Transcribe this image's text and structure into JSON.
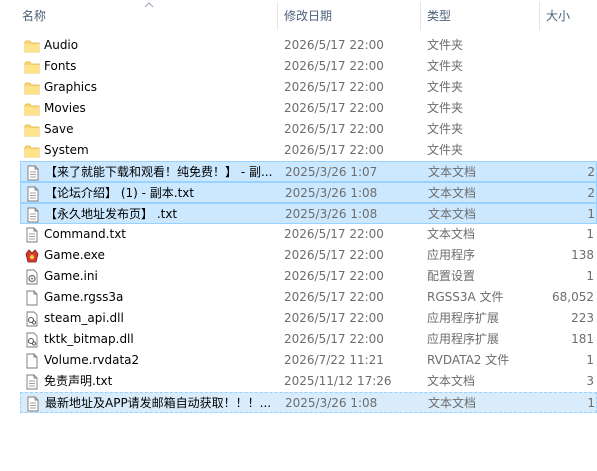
{
  "columns": {
    "name": "名称",
    "date": "修改日期",
    "type": "类型",
    "size": "大小"
  },
  "files": [
    {
      "icon": "folder-icon",
      "name": "Audio",
      "date": "2026/5/17 22:00",
      "type": "文件夹",
      "size": "",
      "selected": false
    },
    {
      "icon": "folder-icon",
      "name": "Fonts",
      "date": "2026/5/17 22:00",
      "type": "文件夹",
      "size": "",
      "selected": false
    },
    {
      "icon": "folder-icon",
      "name": "Graphics",
      "date": "2026/5/17 22:00",
      "type": "文件夹",
      "size": "",
      "selected": false
    },
    {
      "icon": "folder-icon",
      "name": "Movies",
      "date": "2026/5/17 22:00",
      "type": "文件夹",
      "size": "",
      "selected": false
    },
    {
      "icon": "folder-icon",
      "name": "Save",
      "date": "2026/5/17 22:00",
      "type": "文件夹",
      "size": "",
      "selected": false
    },
    {
      "icon": "folder-icon",
      "name": "System",
      "date": "2026/5/17 22:00",
      "type": "文件夹",
      "size": "",
      "selected": false
    },
    {
      "icon": "text-file-icon",
      "name": "【来了就能下载和观看！纯免费！】 - 副...",
      "date": "2025/3/26 1:07",
      "type": "文本文档",
      "size": "2",
      "selected": true
    },
    {
      "icon": "text-file-icon",
      "name": "【论坛介绍】 (1) - 副本.txt",
      "date": "2025/3/26 1:08",
      "type": "文本文档",
      "size": "2",
      "selected": true
    },
    {
      "icon": "text-file-icon",
      "name": "【永久地址发布页】 .txt",
      "date": "2025/3/26 1:08",
      "type": "文本文档",
      "size": "1",
      "selected": true
    },
    {
      "icon": "text-file-icon",
      "name": "Command.txt",
      "date": "2026/5/17 22:00",
      "type": "文本文档",
      "size": "1",
      "selected": false
    },
    {
      "icon": "game-exe-icon",
      "name": "Game.exe",
      "date": "2026/5/17 22:00",
      "type": "应用程序",
      "size": "138",
      "selected": false
    },
    {
      "icon": "config-file-icon",
      "name": "Game.ini",
      "date": "2026/5/17 22:00",
      "type": "配置设置",
      "size": "1",
      "selected": false
    },
    {
      "icon": "generic-file-icon",
      "name": "Game.rgss3a",
      "date": "2026/5/17 22:00",
      "type": "RGSS3A 文件",
      "size": "68,052",
      "selected": false
    },
    {
      "icon": "dll-file-icon",
      "name": "steam_api.dll",
      "date": "2026/5/17 22:00",
      "type": "应用程序扩展",
      "size": "223",
      "selected": false
    },
    {
      "icon": "dll-file-icon",
      "name": "tktk_bitmap.dll",
      "date": "2026/5/17 22:00",
      "type": "应用程序扩展",
      "size": "181",
      "selected": false
    },
    {
      "icon": "generic-file-icon",
      "name": "Volume.rvdata2",
      "date": "2026/7/22 11:21",
      "type": "RVDATA2 文件",
      "size": "1",
      "selected": false
    },
    {
      "icon": "text-file-icon",
      "name": "免责声明.txt",
      "date": "2025/11/12 17:26",
      "type": "文本文档",
      "size": "3",
      "selected": false
    },
    {
      "icon": "text-file-icon",
      "name": "最新地址及APP请发邮箱自动获取！！！...",
      "date": "2025/3/26 1:08",
      "type": "文本文档",
      "size": "1",
      "selected": true
    }
  ]
}
